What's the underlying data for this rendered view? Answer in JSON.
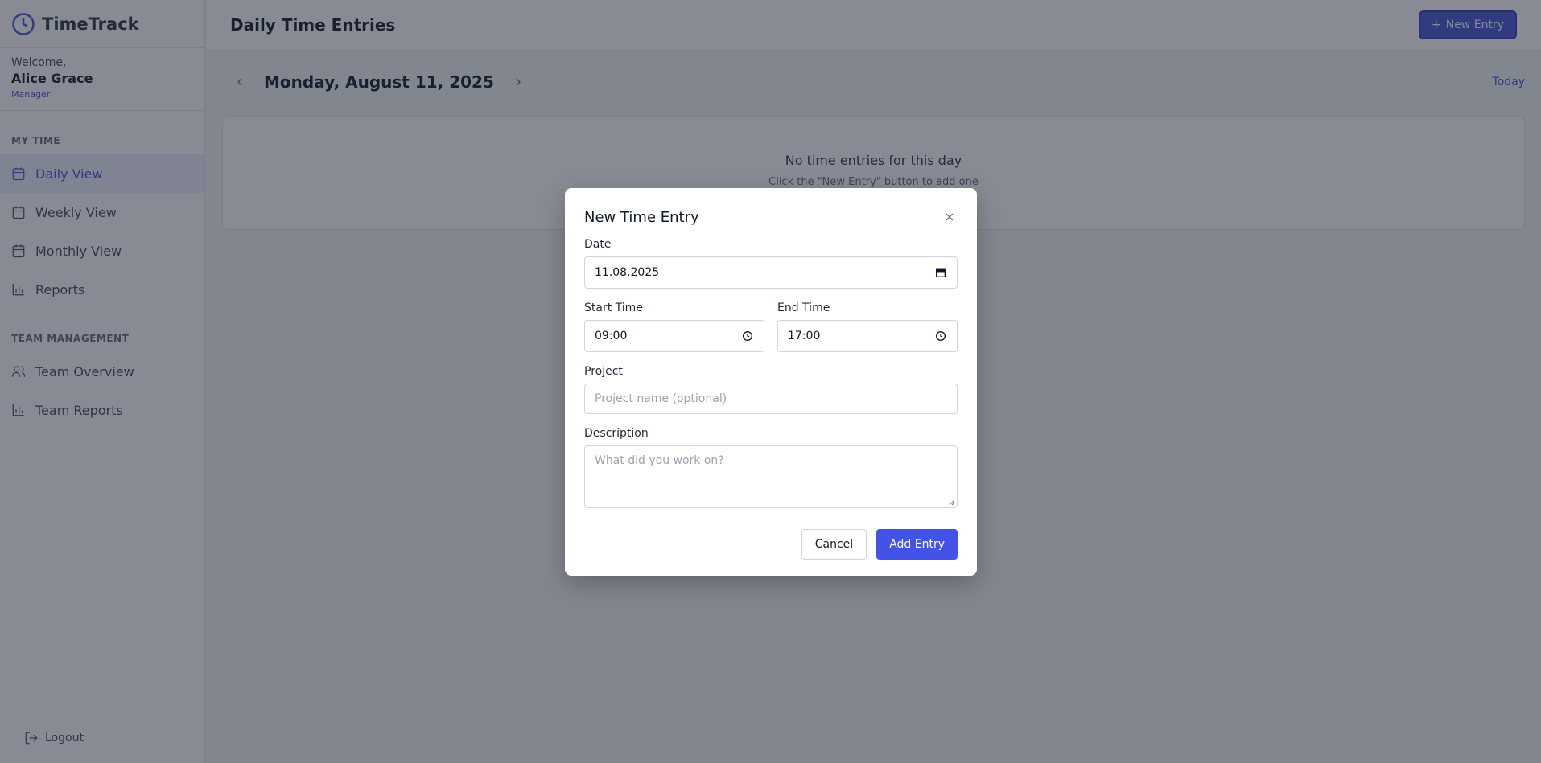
{
  "app": {
    "name": "TimeTrack"
  },
  "user": {
    "welcome": "Welcome,",
    "name": "Alice Grace",
    "role": "Manager"
  },
  "sidebar": {
    "my_time_title": "MY TIME",
    "my_time_items": [
      {
        "label": "Daily View",
        "icon": "calendar-icon",
        "active": true
      },
      {
        "label": "Weekly View",
        "icon": "calendar-week-icon",
        "active": false
      },
      {
        "label": "Monthly View",
        "icon": "calendar-month-icon",
        "active": false
      },
      {
        "label": "Reports",
        "icon": "bar-chart-icon",
        "active": false
      }
    ],
    "team_title": "TEAM MANAGEMENT",
    "team_items": [
      {
        "label": "Team Overview",
        "icon": "users-icon"
      },
      {
        "label": "Team Reports",
        "icon": "bar-chart-icon"
      }
    ],
    "logout_label": "Logout"
  },
  "header": {
    "title": "Daily Time Entries",
    "new_entry_label": "New Entry"
  },
  "datebar": {
    "date": "Monday, August 11, 2025",
    "today_label": "Today"
  },
  "empty_state": {
    "title": "No time entries for this day",
    "hint": "Click the \"New Entry\" button to add one"
  },
  "modal": {
    "title": "New Time Entry",
    "date_label": "Date",
    "date_value": "11.08.2025",
    "start_label": "Start Time",
    "start_value": "09:00",
    "end_label": "End Time",
    "end_value": "17:00",
    "project_label": "Project",
    "project_placeholder": "Project name (optional)",
    "description_label": "Description",
    "description_placeholder": "What did you work on?",
    "cancel_label": "Cancel",
    "add_label": "Add Entry"
  },
  "colors": {
    "accent": "#4f5fd8",
    "primary_button": "#4353e8",
    "overlay": "rgba(17,24,39,0.5)"
  }
}
